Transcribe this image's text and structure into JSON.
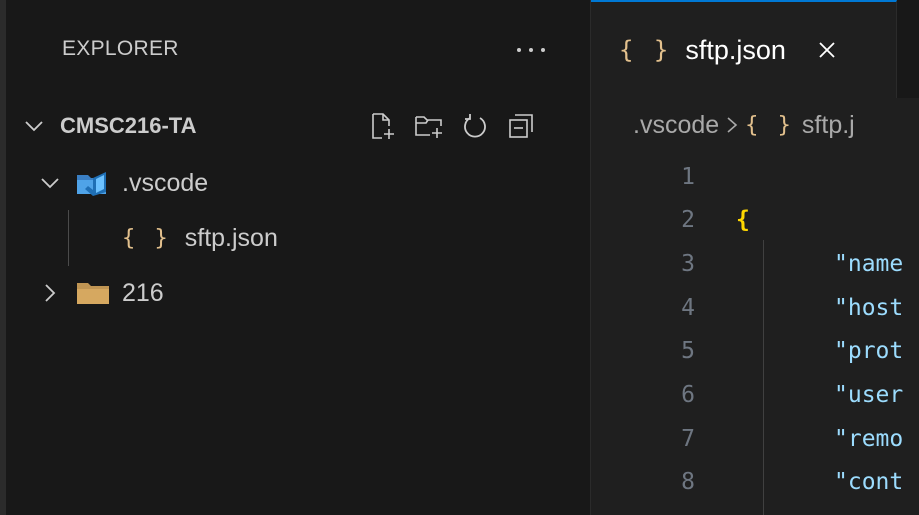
{
  "sidebar": {
    "title": "EXPLORER",
    "folder": {
      "name": "CMSC216-TA",
      "expanded": true
    },
    "tree": [
      {
        "label": ".vscode",
        "type": "folder",
        "expanded": true,
        "icon": "vscode-folder-icon"
      },
      {
        "label": "sftp.json",
        "type": "file",
        "icon": "json-braces-icon"
      },
      {
        "label": "216",
        "type": "folder",
        "expanded": false,
        "icon": "folder-icon"
      }
    ]
  },
  "editor": {
    "tab": {
      "label": "sftp.json",
      "active": true
    },
    "breadcrumb": {
      "root": ".vscode",
      "file": "sftp.j"
    },
    "lines": [
      {
        "n": "1",
        "text": ""
      },
      {
        "n": "2",
        "text": "{"
      },
      {
        "n": "3",
        "text": "\"name"
      },
      {
        "n": "4",
        "text": "\"host"
      },
      {
        "n": "5",
        "text": "\"prot"
      },
      {
        "n": "6",
        "text": "\"user"
      },
      {
        "n": "7",
        "text": "\"remo"
      },
      {
        "n": "8",
        "text": "\"cont"
      }
    ]
  },
  "icons": {
    "braces": "{ }"
  },
  "colors": {
    "accent": "#0078d4",
    "json_icon": "#e2c08d",
    "bracket": "#ffd700",
    "string_key": "#9cdcfe",
    "folder": "#c09553",
    "vscode_folder": "#3a96dd"
  }
}
